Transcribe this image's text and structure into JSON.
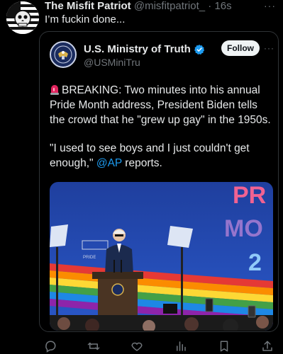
{
  "post": {
    "display_name": "The Misfit Patriot",
    "handle": "@misfitpatriot_",
    "separator": "·",
    "time": "16s",
    "text": "I’m fuckin done...",
    "more": "···"
  },
  "quote": {
    "display_name": "U.S. Ministry of Truth",
    "handle": "@USMiniTru",
    "follow_label": "Follow",
    "more": "···",
    "paragraph1": "BREAKING: Two minutes into his annual Pride Month address, President Biden tells the crowd that he \"grew up gay\" in the 1950s.",
    "paragraph2_before": "\"I used to see boys and I just couldn't get enough,\" ",
    "paragraph2_mention": "@AP",
    "paragraph2_after": " reports.",
    "media_banner_letters": [
      "PR",
      "MO",
      "2"
    ],
    "podium_sign": "PRIDE"
  },
  "actions": [
    {
      "name": "reply-icon"
    },
    {
      "name": "repost-icon"
    },
    {
      "name": "like-icon"
    },
    {
      "name": "views-icon"
    },
    {
      "name": "bookmark-icon"
    },
    {
      "name": "share-icon"
    }
  ],
  "colors": {
    "background": "#000000",
    "text": "#e7e9ea",
    "muted": "#71767b",
    "link": "#1d9bf0",
    "verified": "#1d9bf0",
    "siren": "#e0245e"
  }
}
